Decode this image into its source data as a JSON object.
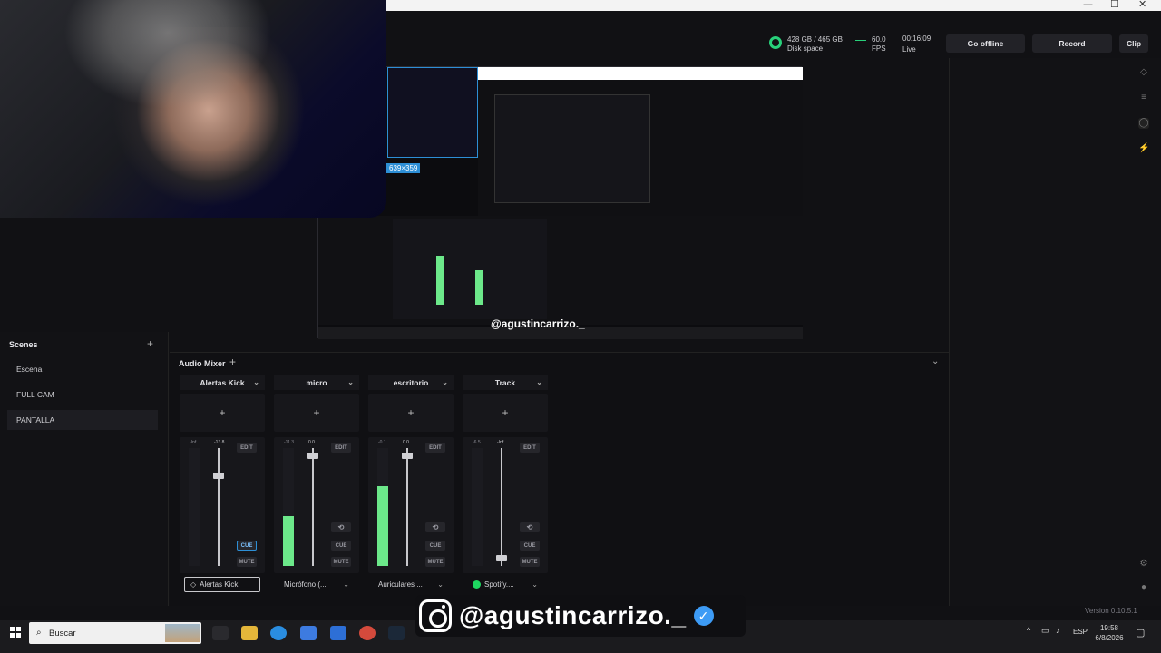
{
  "window": {
    "minimize": "—",
    "maximize": "☐",
    "close": "✕"
  },
  "stats": {
    "disk_value": "428 GB / 465 GB",
    "disk_label": "Disk space",
    "fps_value": "60.0",
    "fps_label": "FPS",
    "time_value": "00:16:09",
    "time_label": "Live"
  },
  "topbar": {
    "go_offline": "Go offline",
    "record": "Record",
    "clip": "Clip"
  },
  "preview": {
    "selection_size": "639×359",
    "handle": "@agustincarrizo._"
  },
  "scenes": {
    "title": "Scenes",
    "add": "+",
    "items": [
      {
        "label": "Escena"
      },
      {
        "label": "FULL CAM"
      },
      {
        "label": "PANTALLA"
      }
    ]
  },
  "audio": {
    "title": "Audio Mixer",
    "add": "+",
    "collapse": "⌄",
    "channels": [
      {
        "name": "Alertas Kick",
        "add": "+",
        "db": "-13.8",
        "level": "-Inf",
        "edit": "EDIT",
        "cue": "CUE",
        "mute": "MUTE",
        "device": "Alertas Kick",
        "meter": 0.0,
        "fader": 0.78
      },
      {
        "name": "micro",
        "add": "+",
        "db": "0.0",
        "level": "-11.3",
        "edit": "EDIT",
        "cue": "CUE",
        "mute": "MUTE",
        "device": "Micrófono (...",
        "meter": 0.42,
        "fader": 0.96
      },
      {
        "name": "escritorio",
        "add": "+",
        "db": "0.0",
        "level": "-0.1",
        "edit": "EDIT",
        "cue": "CUE",
        "mute": "MUTE",
        "device": "Auriculares ...",
        "meter": 0.68,
        "fader": 0.96
      },
      {
        "name": "Track",
        "add": "+",
        "db": "-Inf",
        "level": "-6.5",
        "edit": "EDIT",
        "cue": "CUE",
        "mute": "MUTE",
        "device": "Spotify....",
        "meter": 0.0,
        "fader": 0.05
      }
    ]
  },
  "version": "Version 0.10.5.1",
  "overlay": {
    "handle": "@agustincarrizo._"
  },
  "taskbar": {
    "search_placeholder": "Buscar",
    "language": "ESP",
    "time": "19:58",
    "date": "6/8/2026"
  },
  "colors": {
    "accent_green": "#6ce88a",
    "live_green": "#28d07a",
    "select_blue": "#2d8fd6"
  }
}
